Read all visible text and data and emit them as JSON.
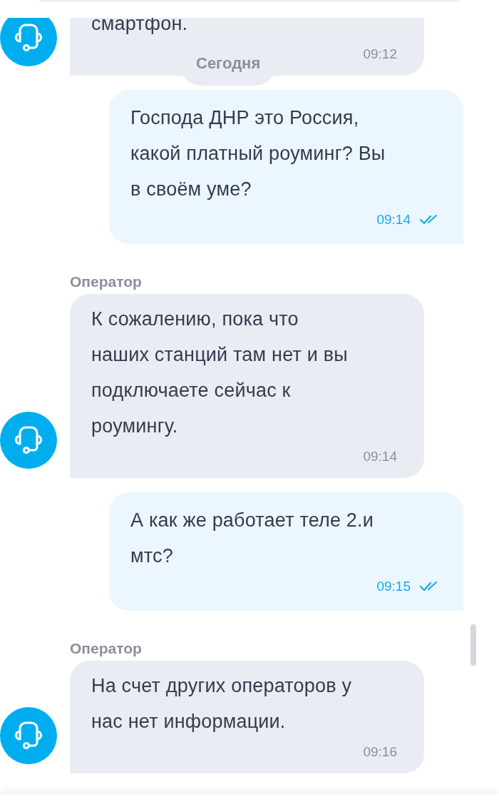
{
  "messages": [
    {
      "kind": "operator",
      "text": "смартфон.",
      "time": "09:12"
    },
    {
      "kind": "date",
      "text": "Сегодня"
    },
    {
      "kind": "user",
      "text": "Господа ДНР это Россия,\nкакой платный роуминг? Вы\nв своём уме?",
      "time": "09:14",
      "read": true
    },
    {
      "kind": "operator",
      "sender": "Оператор",
      "text": "К сожалению, пока что\nнаших станций там нет и вы\nподключаете сейчас к\nроумингу.",
      "time": "09:14"
    },
    {
      "kind": "user",
      "text": "А как же работает теле 2.и\nмтс?",
      "time": "09:15",
      "read": true
    },
    {
      "kind": "operator",
      "sender": "Оператор",
      "text": "На счет других операторов у\nнас нет информации.",
      "time": "09:16"
    }
  ]
}
